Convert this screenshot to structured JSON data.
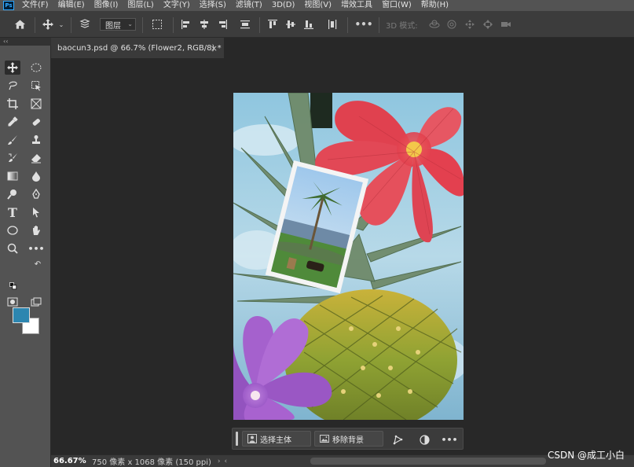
{
  "app": {
    "logo_text": "Ps"
  },
  "menu": [
    "文件(F)",
    "编辑(E)",
    "图像(I)",
    "图层(L)",
    "文字(Y)",
    "选择(S)",
    "滤镜(T)",
    "3D(D)",
    "视图(V)",
    "增效工具",
    "窗口(W)",
    "帮助(H)"
  ],
  "options": {
    "layer_select": "图层",
    "mode3d_label": "3D 模式:"
  },
  "tools_panel": {
    "collapse_glyph": "‹‹"
  },
  "document": {
    "tab_title": "baocun3.psd @ 66.7% (Flower2, RGB/8) *",
    "close_glyph": "×"
  },
  "context_bar": {
    "select_subject": "选择主体",
    "remove_bg": "移除背景",
    "more": "•••"
  },
  "status": {
    "zoom": "66.67%",
    "doc_size": "750 像素 x 1068 像素 (150 ppi)",
    "arrow": "›",
    "arrow2": "‹"
  },
  "watermark": "CSDN @成工小白",
  "colors": {
    "foreground": "#2c86b0",
    "background": "#ffffff"
  }
}
